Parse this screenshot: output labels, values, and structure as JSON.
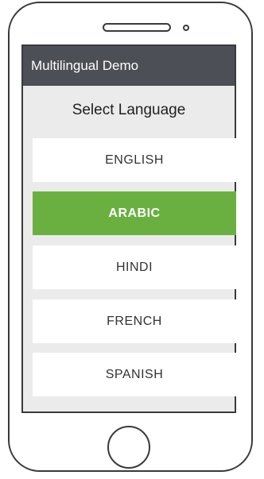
{
  "app": {
    "title": "Multilingual Demo"
  },
  "screen": {
    "heading": "Select Language"
  },
  "languages": [
    {
      "label": "ENGLISH",
      "selected": false
    },
    {
      "label": "ARABIC",
      "selected": true
    },
    {
      "label": "HINDI",
      "selected": false
    },
    {
      "label": "FRENCH",
      "selected": false
    },
    {
      "label": "SPANISH",
      "selected": false
    }
  ],
  "colors": {
    "appbar": "#4c4f55",
    "selected_accent": "#6ab041",
    "screen_background": "#ebebeb",
    "device_outline": "#3a3a3a"
  },
  "icons": {
    "speaker": "speaker-slot-icon",
    "camera": "front-camera-icon",
    "home": "home-button-icon"
  }
}
